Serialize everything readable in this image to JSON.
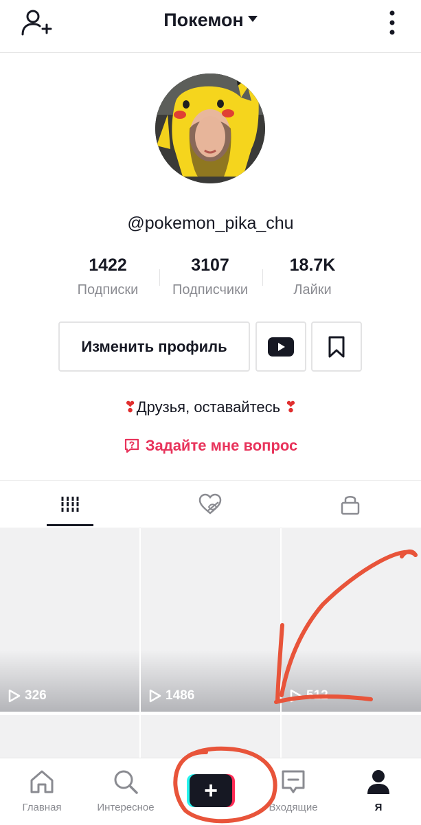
{
  "header": {
    "title": "Покемон"
  },
  "profile": {
    "username": "@pokemon_pika_chu"
  },
  "stats": [
    {
      "value": "1422",
      "label": "Подписки"
    },
    {
      "value": "3107",
      "label": "Подписчики"
    },
    {
      "value": "18.7K",
      "label": "Лайки"
    }
  ],
  "actions": {
    "edit_label": "Изменить профиль"
  },
  "bio": {
    "text": "Друзья, оставайтесь"
  },
  "ask": {
    "label": "Задайте мне вопрос"
  },
  "videos": [
    {
      "views": "326"
    },
    {
      "views": "1486"
    },
    {
      "views": "512"
    }
  ],
  "nav": {
    "home": "Главная",
    "discover": "Интересное",
    "create": "+",
    "inbox": "Входящие",
    "me": "Я"
  },
  "colors": {
    "accent": "#e8335b",
    "text": "#161823",
    "muted": "#8a8b91",
    "annotation": "#e8543a"
  }
}
